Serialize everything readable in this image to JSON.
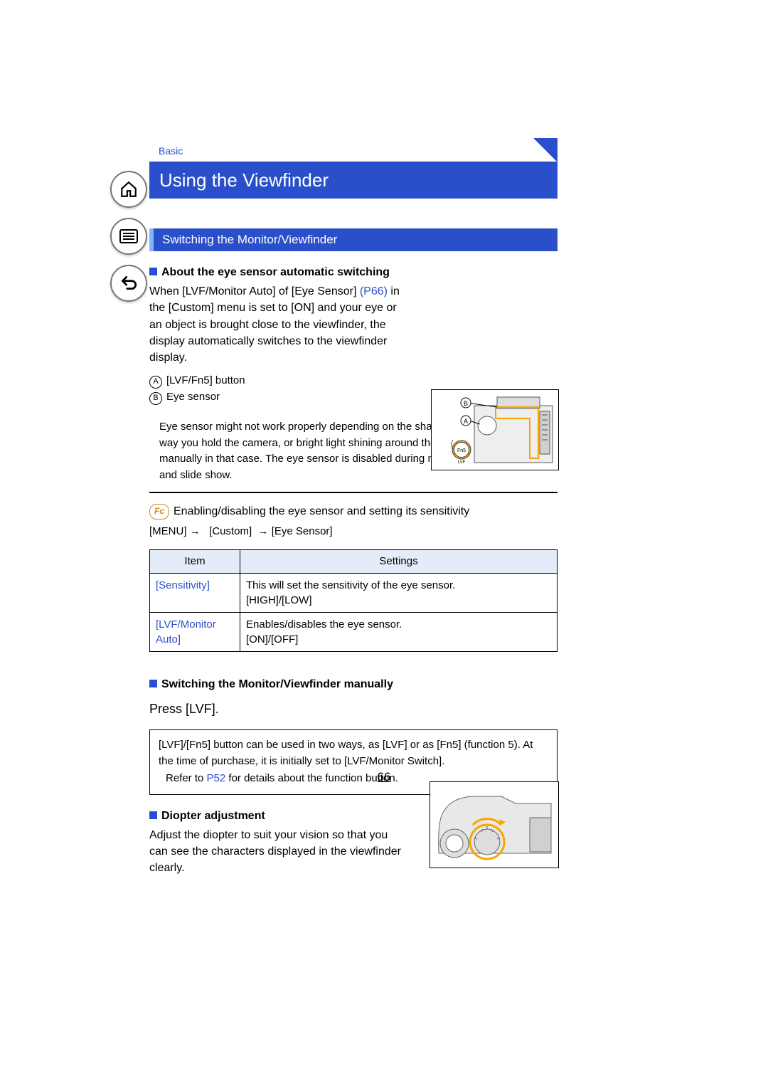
{
  "breadcrumb": "Basic",
  "title": "Using the Viewfinder",
  "subheading": "Switching the Monitor/Viewfinder",
  "section1": {
    "heading": "About the eye sensor automatic switching",
    "text_prefix": "When [LVF/Monitor Auto] of [Eye Sensor] ",
    "page_ref": "(P66)",
    "text_suffix": " in the [Custom] menu is set to [ON] and your eye or an object is brought close to the viewfinder, the display automatically switches to the viewfinder display.",
    "markerA": "[LVF/Fn5] button",
    "markerB": "Eye sensor",
    "note": "Eye sensor might not work properly depending on the shape of your eyeglasses, the way you hold the camera, or bright light shining around the eyepiece. Switch manually in that case. The eye sensor is disabled during motion picture playback and slide show."
  },
  "fc": {
    "label": "Enabling/disabling the eye sensor and setting its sensitivity",
    "menu_path_parts": [
      "[MENU]",
      "[Custom]",
      "[Eye Sensor]"
    ]
  },
  "table": {
    "head_item": "Item",
    "head_settings": "Settings",
    "rows": [
      {
        "item": "[Sensitivity]",
        "settings": "This will set the sensitivity of the eye sensor.\n[HIGH]/[LOW]"
      },
      {
        "item": "[LVF/Monitor Auto]",
        "settings": "Enables/disables the eye sensor.\n[ON]/[OFF]"
      }
    ]
  },
  "section2": {
    "heading": "Switching the Monitor/Viewfinder manually",
    "press": "Press [LVF].",
    "info_text": "[LVF]/[Fn5] button can be used in two ways, as [LVF] or as [Fn5] (function 5). At the time of purchase, it is initially set to [LVF/Monitor Switch].",
    "info_ref_prefix": "Refer to ",
    "info_ref_link": "P52",
    "info_ref_suffix": " for details about the function button."
  },
  "section3": {
    "heading": "Diopter adjustment",
    "text": "Adjust the diopter to suit your vision so that you can see the characters displayed in the viewfinder clearly."
  },
  "page_number": "66",
  "illus": {
    "labelA": "A",
    "labelB": "B",
    "fn5": "Fn5",
    "lvf": "LVF"
  }
}
